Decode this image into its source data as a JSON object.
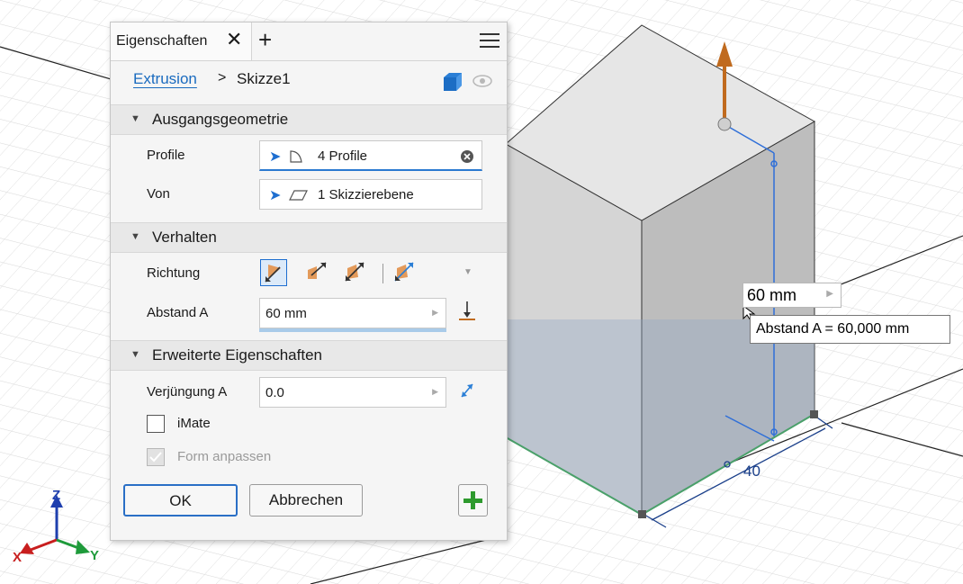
{
  "panel": {
    "tab_title": "Eigenschaften",
    "close_glyph": "✕",
    "add_glyph": "+",
    "breadcrumb_link": "Extrusion",
    "breadcrumb_sep": ">",
    "breadcrumb_current": "Skizze1",
    "sections": {
      "input_geometry": "Ausgangsgeometrie",
      "behavior": "Verhalten",
      "advanced": "Erweiterte Eigenschaften"
    },
    "fields": {
      "profile_label": "Profile",
      "profile_value": "4 Profile",
      "from_label": "Von",
      "from_value": "1 Skizzierebene",
      "direction_label": "Richtung",
      "distance_label": "Abstand A",
      "distance_value": "60 mm",
      "taper_label": "Verjüngung A",
      "taper_value": "0.0"
    },
    "options": {
      "imate_label": "iMate",
      "imate_checked": false,
      "fit_shape_label": "Form anpassen",
      "fit_shape_checked": true,
      "fit_shape_enabled": false
    },
    "buttons": {
      "ok": "OK",
      "cancel": "Abbrechen"
    }
  },
  "viewport": {
    "dimension_input": "60 mm",
    "tooltip": "Abstand A = 60,000 mm",
    "base_dimension": "40",
    "triad": {
      "z": "Z",
      "x": "X",
      "y": "Y"
    }
  },
  "colors": {
    "accent": "#1e6ed0",
    "manipulator": "#c06a1e",
    "add_button": "#2e9a2e",
    "triad_x": "#c81e1e",
    "triad_y": "#1e9a3a",
    "triad_z": "#1e3fae"
  }
}
